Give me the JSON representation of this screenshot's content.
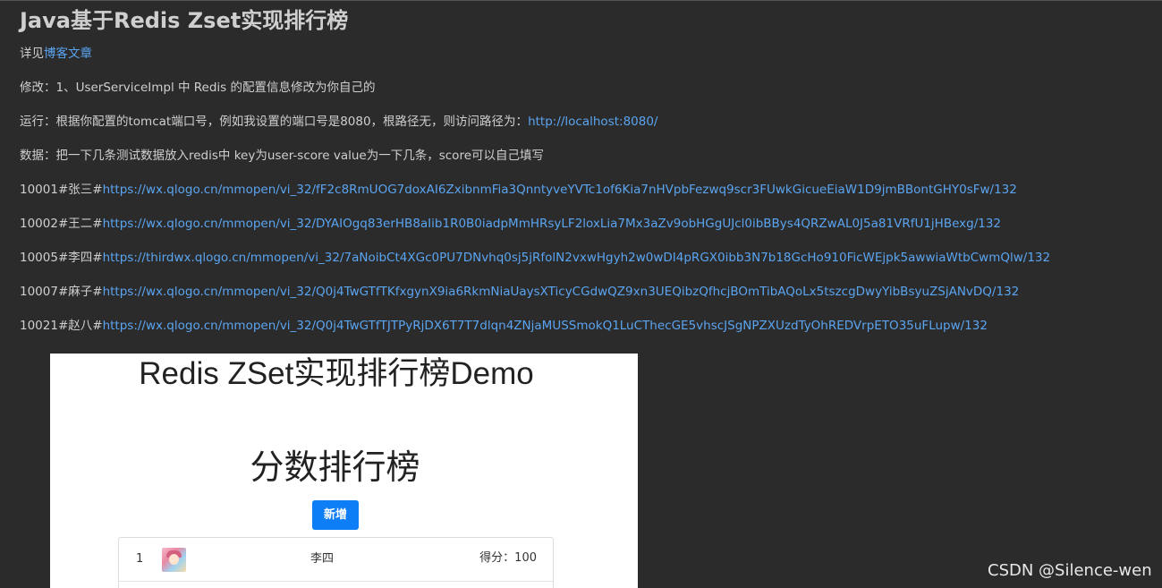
{
  "readme": {
    "title": "Java基于Redis Zset实现排行榜",
    "see_prefix": "详见",
    "blog_link": "博客文章",
    "modify": "修改：1、UserServiceImpl 中 Redis 的配置信息修改为你自己的",
    "run_prefix": "运行：根据你配置的tomcat端口号，例如我设置的端口号是8080，根路径无，则访问路径为：",
    "run_link": "http://localhost:8080/",
    "data_desc": "数据：把一下几条测试数据放入redis中 key为user-score value为一下几条，score可以自己填写",
    "records": [
      {
        "prefix": "10001#张三#",
        "url": "https://wx.qlogo.cn/mmopen/vi_32/fF2c8RmUOG7doxAI6ZxibnmFia3QnntyveYVTc1of6Kia7nHVpbFezwq9scr3FUwkGicueEiaW1D9jmBBontGHY0sFw/132"
      },
      {
        "prefix": "10002#王二#",
        "url": "https://wx.qlogo.cn/mmopen/vi_32/DYAIOgq83erHB8aIib1R0B0iadpMmHRsyLF2loxLia7Mx3aZv9obHGgUJcl0ibBBys4QRZwAL0J5a81VRfU1jHBexg/132"
      },
      {
        "prefix": "10005#李四#",
        "url": "https://thirdwx.qlogo.cn/mmopen/vi_32/7aNoibCt4XGc0PU7DNvhq0sj5jRfolN2vxwHgyh2w0wDI4pRGX0ibb3N7b18GcHo910FicWEjpk5awwiaWtbCwmQlw/132"
      },
      {
        "prefix": "10007#麻子#",
        "url": "https://wx.qlogo.cn/mmopen/vi_32/Q0j4TwGTfTKfxgynX9ia6RkmNiaUaysXTicyCGdwQZ9xn3UEQibzQfhcjBOmTibAQoLx5tszcgDwyYibBsyuZSjANvDQ/132"
      },
      {
        "prefix": "10021#赵八#",
        "url": "https://wx.qlogo.cn/mmopen/vi_32/Q0j4TwGTfTJTPyRjDX6T7T7dlqn4ZNjaMUSSmokQ1LuCThecGE5vhscJSgNPZXUzdTyOhREDVrpETO35uFLupw/132"
      }
    ]
  },
  "demo": {
    "title": "Redis ZSet实现排行榜Demo",
    "subtitle": "分数排行榜",
    "add_label": "新增",
    "rows": [
      {
        "rank": "1",
        "name": "李四",
        "score_label": "得分：",
        "score": "100"
      }
    ]
  },
  "watermark": "CSDN @Silence-wen"
}
